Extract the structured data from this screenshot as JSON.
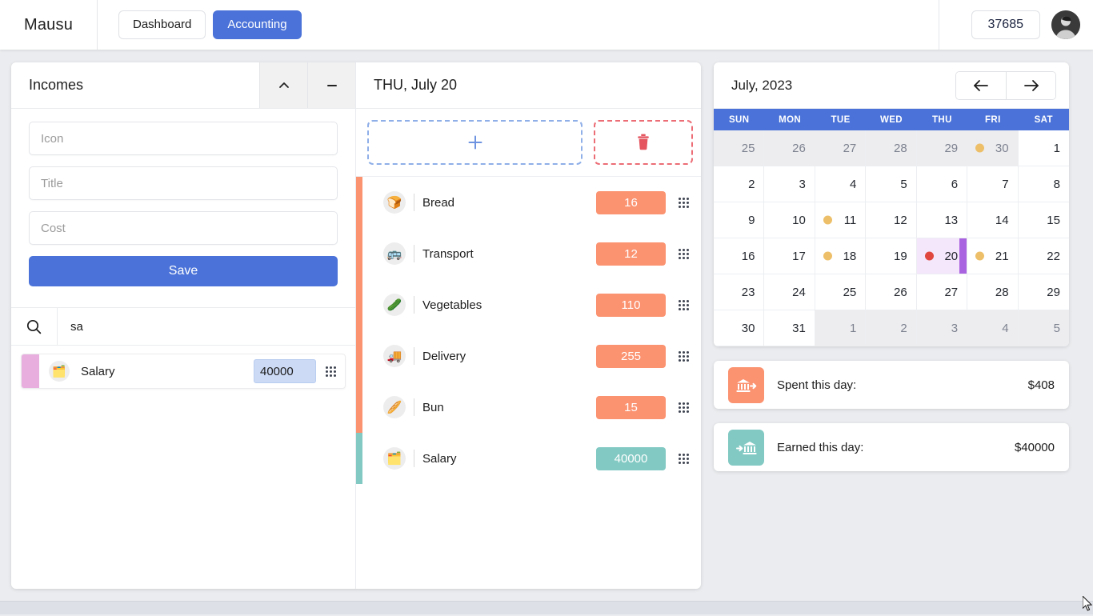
{
  "app": {
    "brand": "Mausu",
    "balance": "37685",
    "avatar_icon": "user-avatar"
  },
  "nav": {
    "tabs": [
      {
        "label": "Dashboard",
        "active": false
      },
      {
        "label": "Accounting",
        "active": true
      }
    ]
  },
  "incomes_panel": {
    "title": "Incomes",
    "collapse_icon": "chevron-up-icon",
    "minimize_icon": "minus-icon",
    "form": {
      "icon_placeholder": "Icon",
      "icon_value": "",
      "title_placeholder": "Title",
      "title_value": "",
      "cost_placeholder": "Cost",
      "cost_value": "",
      "save_label": "Save"
    },
    "search": {
      "icon": "search-icon",
      "value": "sa",
      "placeholder": ""
    },
    "results": [
      {
        "emoji": "🗂️",
        "title": "Salary",
        "value": "40000",
        "color": "#e7aede",
        "handle_icon": "drag-handle-icon"
      }
    ]
  },
  "day_panel": {
    "date_title": "THU, July 20",
    "add_button": {
      "icon": "plus-icon",
      "label": ""
    },
    "delete_button": {
      "icon": "trash-icon",
      "label": ""
    },
    "stripe_expense_color": "#fb9270",
    "stripe_income_color": "#82c9c3",
    "transactions": [
      {
        "emoji": "🍞",
        "title": "Bread",
        "value": "16",
        "kind": "expense",
        "color": "#fb9270"
      },
      {
        "emoji": "🚌",
        "title": "Transport",
        "value": "12",
        "kind": "expense",
        "color": "#fb9270"
      },
      {
        "emoji": "🥒",
        "title": "Vegetables",
        "value": "110",
        "kind": "expense",
        "color": "#fb9270"
      },
      {
        "emoji": "🚚",
        "title": "Delivery",
        "value": "255",
        "kind": "expense",
        "color": "#fb9270"
      },
      {
        "emoji": "🥖",
        "title": "Bun",
        "value": "15",
        "kind": "expense",
        "color": "#fb9270"
      },
      {
        "emoji": "🗂️",
        "title": "Salary",
        "value": "40000",
        "kind": "income",
        "color": "#82c9c3"
      }
    ]
  },
  "calendar": {
    "title": "July, 2023",
    "prev_icon": "arrow-left-icon",
    "next_icon": "arrow-right-icon",
    "weekdays": [
      "SUN",
      "MON",
      "TUE",
      "WED",
      "THU",
      "FRI",
      "SAT"
    ],
    "days": [
      {
        "n": "25",
        "other": true
      },
      {
        "n": "26",
        "other": true
      },
      {
        "n": "27",
        "other": true
      },
      {
        "n": "28",
        "other": true
      },
      {
        "n": "29",
        "other": true
      },
      {
        "n": "30",
        "other": true,
        "dot": "#edbf68"
      },
      {
        "n": "1"
      },
      {
        "n": "2"
      },
      {
        "n": "3"
      },
      {
        "n": "4"
      },
      {
        "n": "5"
      },
      {
        "n": "6"
      },
      {
        "n": "7"
      },
      {
        "n": "8"
      },
      {
        "n": "9"
      },
      {
        "n": "10"
      },
      {
        "n": "11",
        "dot": "#edbf68"
      },
      {
        "n": "12"
      },
      {
        "n": "13"
      },
      {
        "n": "14"
      },
      {
        "n": "15"
      },
      {
        "n": "16"
      },
      {
        "n": "17"
      },
      {
        "n": "18",
        "dot": "#edbf68"
      },
      {
        "n": "19"
      },
      {
        "n": "20",
        "dot": "#e0483f",
        "selected": true,
        "edge": true
      },
      {
        "n": "21",
        "dot": "#edbf68"
      },
      {
        "n": "22"
      },
      {
        "n": "23"
      },
      {
        "n": "24"
      },
      {
        "n": "25"
      },
      {
        "n": "26"
      },
      {
        "n": "27"
      },
      {
        "n": "28"
      },
      {
        "n": "29"
      },
      {
        "n": "30"
      },
      {
        "n": "31"
      },
      {
        "n": "1",
        "other": true
      },
      {
        "n": "2",
        "other": true
      },
      {
        "n": "3",
        "other": true
      },
      {
        "n": "4",
        "other": true
      },
      {
        "n": "5",
        "other": true
      }
    ]
  },
  "summary": [
    {
      "icon": "bank-out-icon",
      "label": "Spent this day:",
      "value": "$408",
      "color": "#fb9270"
    },
    {
      "icon": "bank-in-icon",
      "label": "Earned this day:",
      "value": "$40000",
      "color": "#82c9c3"
    }
  ],
  "colors": {
    "accent": "#4a72d8",
    "expense": "#fb9270",
    "income": "#82c9c3",
    "selected_day_bg": "#f4e6fb",
    "selected_day_edge": "#a962e0",
    "page_bg": "#eaecef"
  }
}
